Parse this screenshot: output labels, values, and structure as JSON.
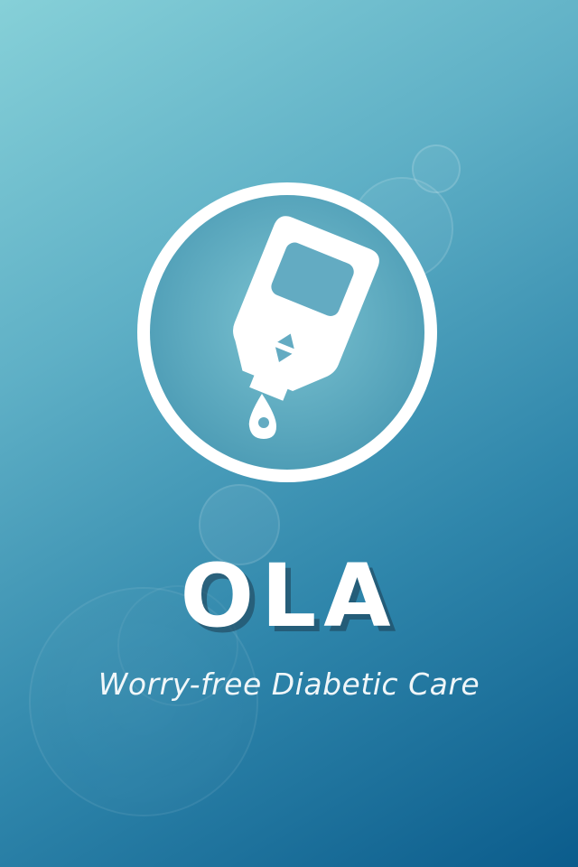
{
  "app": {
    "name": "OLA",
    "tagline": "Worry-free Diabetic Care"
  },
  "logo": {
    "icon": "glucose-meter-icon"
  },
  "colors": {
    "background_top": "#86d0d8",
    "background_bottom": "#0b5c8c",
    "foreground": "#ffffff"
  }
}
